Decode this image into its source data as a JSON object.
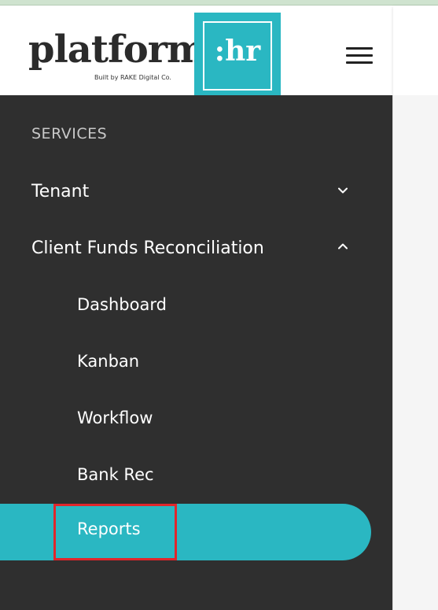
{
  "header": {
    "logo_text": "platform",
    "logo_box_text": ":hr",
    "logo_tagline": "Built by RAKE Digital Co.",
    "menu_icon": "hamburger-menu-icon"
  },
  "sidebar": {
    "section_title": "SERVICES",
    "items": [
      {
        "label": "Tenant",
        "expanded": false,
        "icon": "chevron-down-icon"
      },
      {
        "label": "Client Funds Reconciliation",
        "expanded": true,
        "icon": "chevron-up-icon"
      }
    ],
    "sub_items": [
      {
        "label": "Dashboard"
      },
      {
        "label": "Kanban"
      },
      {
        "label": "Workflow"
      },
      {
        "label": "Bank Rec"
      },
      {
        "label": "Reports",
        "active": true
      }
    ]
  },
  "colors": {
    "accent": "#2ab7c2",
    "sidebar_bg": "#2f2f2f",
    "highlight_border": "#e0262b"
  }
}
